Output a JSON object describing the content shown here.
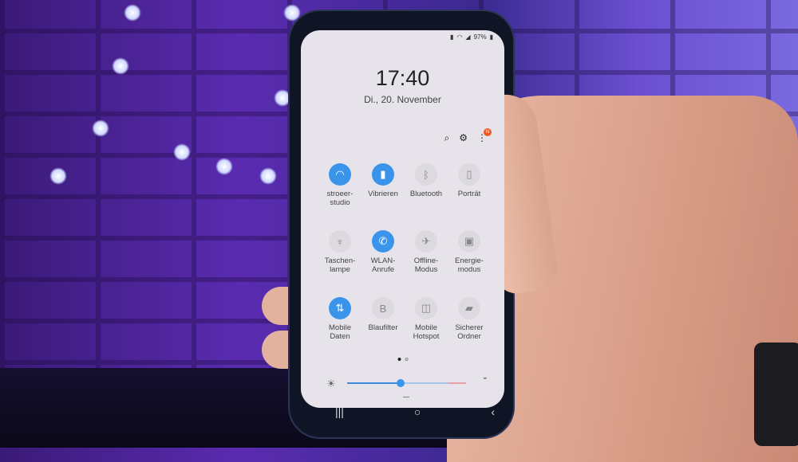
{
  "status_bar": {
    "battery": "97%",
    "icons": [
      "vibrate-icon",
      "wifi-icon",
      "signal-icon",
      "battery-icon"
    ]
  },
  "lockscreen": {
    "time": "17:40",
    "date": "Di., 20. November"
  },
  "toolbar": {
    "icons": [
      "search-icon",
      "gear-icon",
      "more-icon"
    ],
    "notification_badge": "N"
  },
  "tiles": [
    {
      "label": "stroeer-\nstudio",
      "icon": "wifi-icon",
      "active": true,
      "glyph": "◠"
    },
    {
      "label": "Vibrieren",
      "icon": "vibrate-icon",
      "active": true,
      "glyph": "▮"
    },
    {
      "label": "Bluetooth",
      "icon": "bluetooth-icon",
      "active": false,
      "glyph": "ᛒ"
    },
    {
      "label": "Porträt",
      "icon": "portrait-lock-icon",
      "active": false,
      "glyph": "▯"
    },
    {
      "label": "Taschen-\nlampe",
      "icon": "flashlight-icon",
      "active": false,
      "glyph": "♆"
    },
    {
      "label": "WLAN-\nAnrufe",
      "icon": "wifi-call-icon",
      "active": true,
      "glyph": "✆"
    },
    {
      "label": "Offline-\nModus",
      "icon": "airplane-icon",
      "active": false,
      "glyph": "✈"
    },
    {
      "label": "Energie-\nmodus",
      "icon": "power-mode-icon",
      "active": false,
      "glyph": "▣"
    },
    {
      "label": "Mobile\nDaten",
      "icon": "mobile-data-icon",
      "active": true,
      "glyph": "⇅"
    },
    {
      "label": "Blaufilter",
      "icon": "blue-light-filter-icon",
      "active": false,
      "glyph": "B"
    },
    {
      "label": "Mobile\nHotspot",
      "icon": "hotspot-icon",
      "active": false,
      "glyph": "◫"
    },
    {
      "label": "Sicherer\nOrdner",
      "icon": "secure-folder-icon",
      "active": false,
      "glyph": "▰"
    }
  ],
  "pager": {
    "current": 1,
    "total": 2
  },
  "brightness": {
    "level": 0.45
  },
  "nav": {
    "recents": "|||",
    "home": "○",
    "back": "‹"
  },
  "colors": {
    "accent": "#3a95ea",
    "badge": "#f05a22"
  }
}
